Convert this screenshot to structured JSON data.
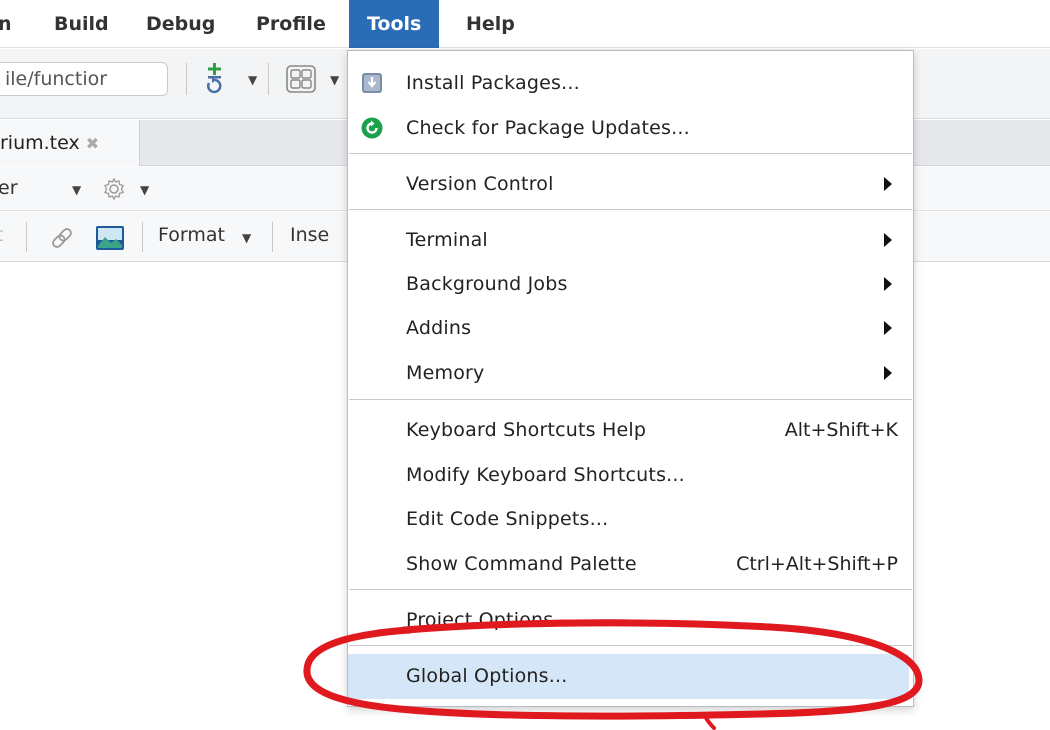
{
  "menubar": {
    "items": [
      {
        "label": "n"
      },
      {
        "label": "Build"
      },
      {
        "label": "Debug"
      },
      {
        "label": "Profile"
      },
      {
        "label": "Tools"
      },
      {
        "label": "Help"
      }
    ],
    "active": "Tools"
  },
  "toolbar": {
    "goto_placeholder": "ile/functior"
  },
  "tabs": [
    {
      "label": "rium.tex"
    }
  ],
  "editor_toolbar": {
    "row1_text": "er",
    "row2_partial_left": "t",
    "format_label": "Format",
    "insert_label": "Inse"
  },
  "tools_menu": {
    "items": [
      {
        "label": "Install Packages...",
        "icon": "install-packages-icon"
      },
      {
        "label": "Check for Package Updates...",
        "icon": "package-updates-icon"
      },
      {
        "label": "Version Control",
        "submenu": true
      },
      {
        "label": "Terminal",
        "submenu": true
      },
      {
        "label": "Background Jobs",
        "submenu": true
      },
      {
        "label": "Addins",
        "submenu": true
      },
      {
        "label": "Memory",
        "submenu": true
      },
      {
        "label": "Keyboard Shortcuts Help",
        "shortcut": "Alt+Shift+K"
      },
      {
        "label": "Modify Keyboard Shortcuts..."
      },
      {
        "label": "Edit Code Snippets..."
      },
      {
        "label": "Show Command Palette",
        "shortcut": "Ctrl+Alt+Shift+P"
      },
      {
        "label": "Project Options..."
      },
      {
        "label": "Global Options...",
        "highlighted": true
      }
    ]
  },
  "colors": {
    "menu_active": "#2a6cb5",
    "highlight": "#d4e6f7",
    "annotation_red": "#e0191f",
    "update_icon_green": "#1aa14a"
  }
}
